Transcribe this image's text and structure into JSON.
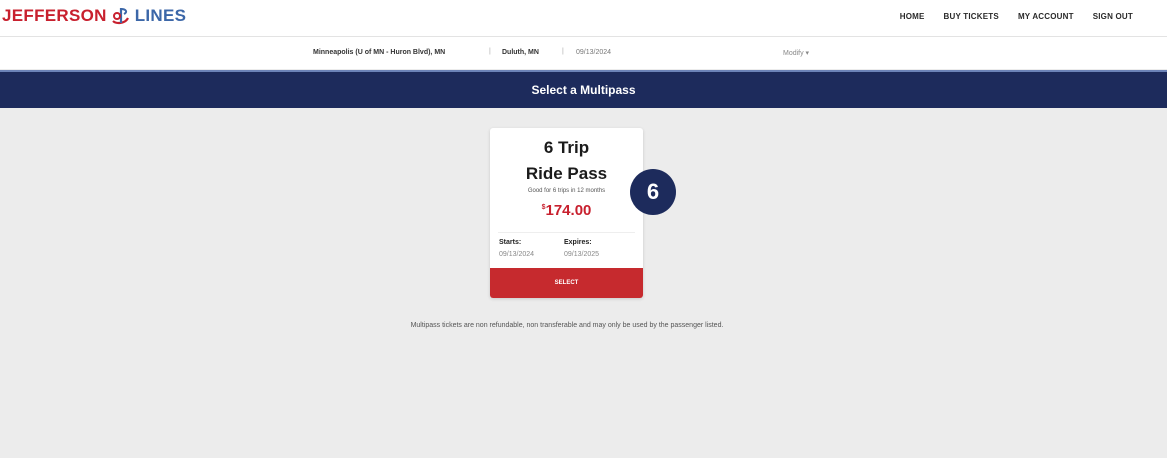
{
  "brand": {
    "part1": "JEFFERSON",
    "part2": "LINES",
    "color_red": "#c8202e",
    "color_blue": "#3c67a8",
    "logo_icon": "bus-swoosh-icon"
  },
  "nav": {
    "items": [
      "HOME",
      "BUY TICKETS",
      "MY ACCOUNT",
      "SIGN OUT"
    ]
  },
  "trip": {
    "origin": "Minneapolis (U of MN - Huron Blvd), MN",
    "separator": "|",
    "destination": "Duluth, MN",
    "date": "09/13/2024",
    "modify_label": "Modify ▾"
  },
  "banner": {
    "title": "Select a Multipass",
    "color": "#1d2b5c"
  },
  "pass": {
    "title_line1": "6 Trip",
    "title_line2": "Ride Pass",
    "description": "Good for 6 trips in 12 months",
    "currency": "$",
    "price": "174.00",
    "price_color": "#c8202e",
    "starts_label": "Starts:",
    "starts_value": "09/13/2024",
    "expires_label": "Expires:",
    "expires_value": "09/13/2025",
    "select_label": "SELECT",
    "select_color": "#c62a2e"
  },
  "step_marker": "6",
  "disclaimer": "Multipass tickets are non refundable, non transferable and may only be used by the passenger listed."
}
